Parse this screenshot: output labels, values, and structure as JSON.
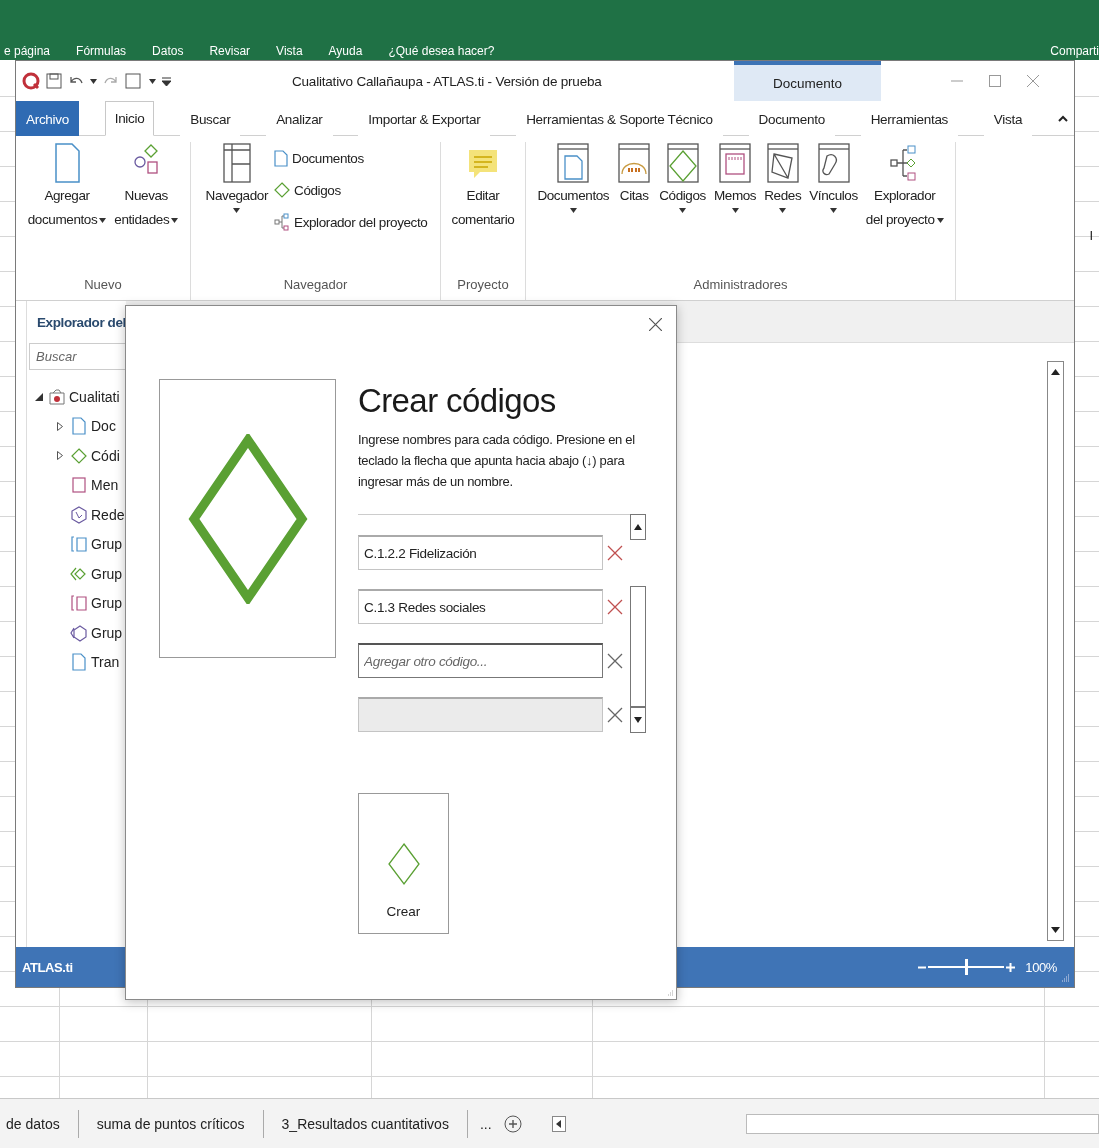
{
  "excel": {
    "menu": [
      "e página",
      "Fórmulas",
      "Datos",
      "Revisar",
      "Vista",
      "Ayuda"
    ],
    "search_hint": "¿Qué desea hacer?",
    "share": "Comparti",
    "cell_text": "I",
    "sheet_tabs": [
      {
        "label": "de datos",
        "selected": false
      },
      {
        "label": "suma de puntos críticos",
        "selected": false
      },
      {
        "label": "3_Resultados cuantitativos",
        "selected": false
      }
    ],
    "more_sheets": "..."
  },
  "window": {
    "title": "Cualitativo Callañaupa - ATLAS.ti - Versión de prueba",
    "context_tab": "Documento",
    "tabs": [
      {
        "label": "Archivo",
        "kind": "file",
        "selected": false
      },
      {
        "label": "Inicio",
        "kind": "tab",
        "selected": true
      },
      {
        "label": "Buscar",
        "kind": "tab",
        "selected": false
      },
      {
        "label": "Analizar",
        "kind": "tab",
        "selected": false
      },
      {
        "label": "Importar & Exportar",
        "kind": "tab",
        "selected": false
      },
      {
        "label": "Herramientas & Soporte Técnico",
        "kind": "tab",
        "selected": false
      },
      {
        "label": "Documento",
        "kind": "tab",
        "selected": false
      },
      {
        "label": "Herramientas",
        "kind": "tab",
        "selected": false
      },
      {
        "label": "Vista",
        "kind": "tab",
        "selected": false
      }
    ],
    "ribbon": [
      {
        "label": "Nuevo",
        "large": [
          {
            "kind": "document",
            "lines": [
              "Agregar",
              "documentos"
            ],
            "dropdown": true
          },
          {
            "kind": "entities",
            "lines": [
              "Nuevas",
              "entidades"
            ],
            "dropdown": true
          }
        ]
      },
      {
        "label": "Navegador",
        "large": [
          {
            "kind": "navigator",
            "lines": [
              "Navegador"
            ],
            "dropdown": true
          }
        ],
        "small": [
          {
            "kind": "doc-small",
            "label": "Documentos"
          },
          {
            "kind": "code-small",
            "label": "Códigos"
          },
          {
            "kind": "explorer-small",
            "label": "Explorador del proyecto"
          }
        ]
      },
      {
        "label": "Proyecto",
        "large": [
          {
            "kind": "comment",
            "lines": [
              "Editar",
              "comentario"
            ],
            "dropdown": false
          }
        ]
      },
      {
        "label": "Administradores",
        "large": [
          {
            "kind": "documents",
            "lines": [
              "Documentos"
            ],
            "dropdown": true
          },
          {
            "kind": "quotes",
            "lines": [
              "Citas"
            ],
            "dropdown": false
          },
          {
            "kind": "codes",
            "lines": [
              "Códigos"
            ],
            "dropdown": true
          },
          {
            "kind": "memos",
            "lines": [
              "Memos"
            ],
            "dropdown": true
          },
          {
            "kind": "networks",
            "lines": [
              "Redes"
            ],
            "dropdown": true
          },
          {
            "kind": "links",
            "lines": [
              "Vínculos"
            ],
            "dropdown": true
          },
          {
            "kind": "explorer",
            "lines": [
              "Explorador",
              "del proyecto"
            ],
            "dropdown": true
          }
        ]
      }
    ],
    "explorer": {
      "title": "Explorador del",
      "search_placeholder": "Buscar",
      "tree": [
        {
          "label": "Cualitati",
          "kind": "project",
          "expanded": true,
          "children": [
            {
              "label": "Doc",
              "kind": "documents",
              "expanded": false
            },
            {
              "label": "Códi",
              "kind": "codes",
              "expanded": false
            },
            {
              "label": "Men",
              "kind": "memos"
            },
            {
              "label": "Rede",
              "kind": "networks"
            },
            {
              "label": "Grup",
              "kind": "doc-groups"
            },
            {
              "label": "Grup",
              "kind": "code-groups"
            },
            {
              "label": "Grup",
              "kind": "memo-groups"
            },
            {
              "label": "Grup",
              "kind": "network-groups"
            },
            {
              "label": "Tran",
              "kind": "transcripts"
            }
          ]
        }
      ]
    },
    "status_bar": {
      "app": "ATLAS.ti",
      "zoom": {
        "level": 0.5,
        "reading": "100%"
      }
    }
  },
  "dialog": {
    "title": "Crear códigos",
    "description": "Ingrese nombres para cada código. Presione en el teclado la flecha que apunta hacia abajo (↓) para ingresar más de un nombre.",
    "codes": [
      {
        "value": "C.1.2.2 Fidelización",
        "disabled": false,
        "focused": false
      },
      {
        "value": "C.1.3 Redes sociales",
        "disabled": false,
        "focused": false
      },
      {
        "placeholder": "Agregar otro código...",
        "disabled": false,
        "focused": true
      },
      {
        "disabled": true,
        "focused": false
      }
    ],
    "button": "Crear"
  }
}
